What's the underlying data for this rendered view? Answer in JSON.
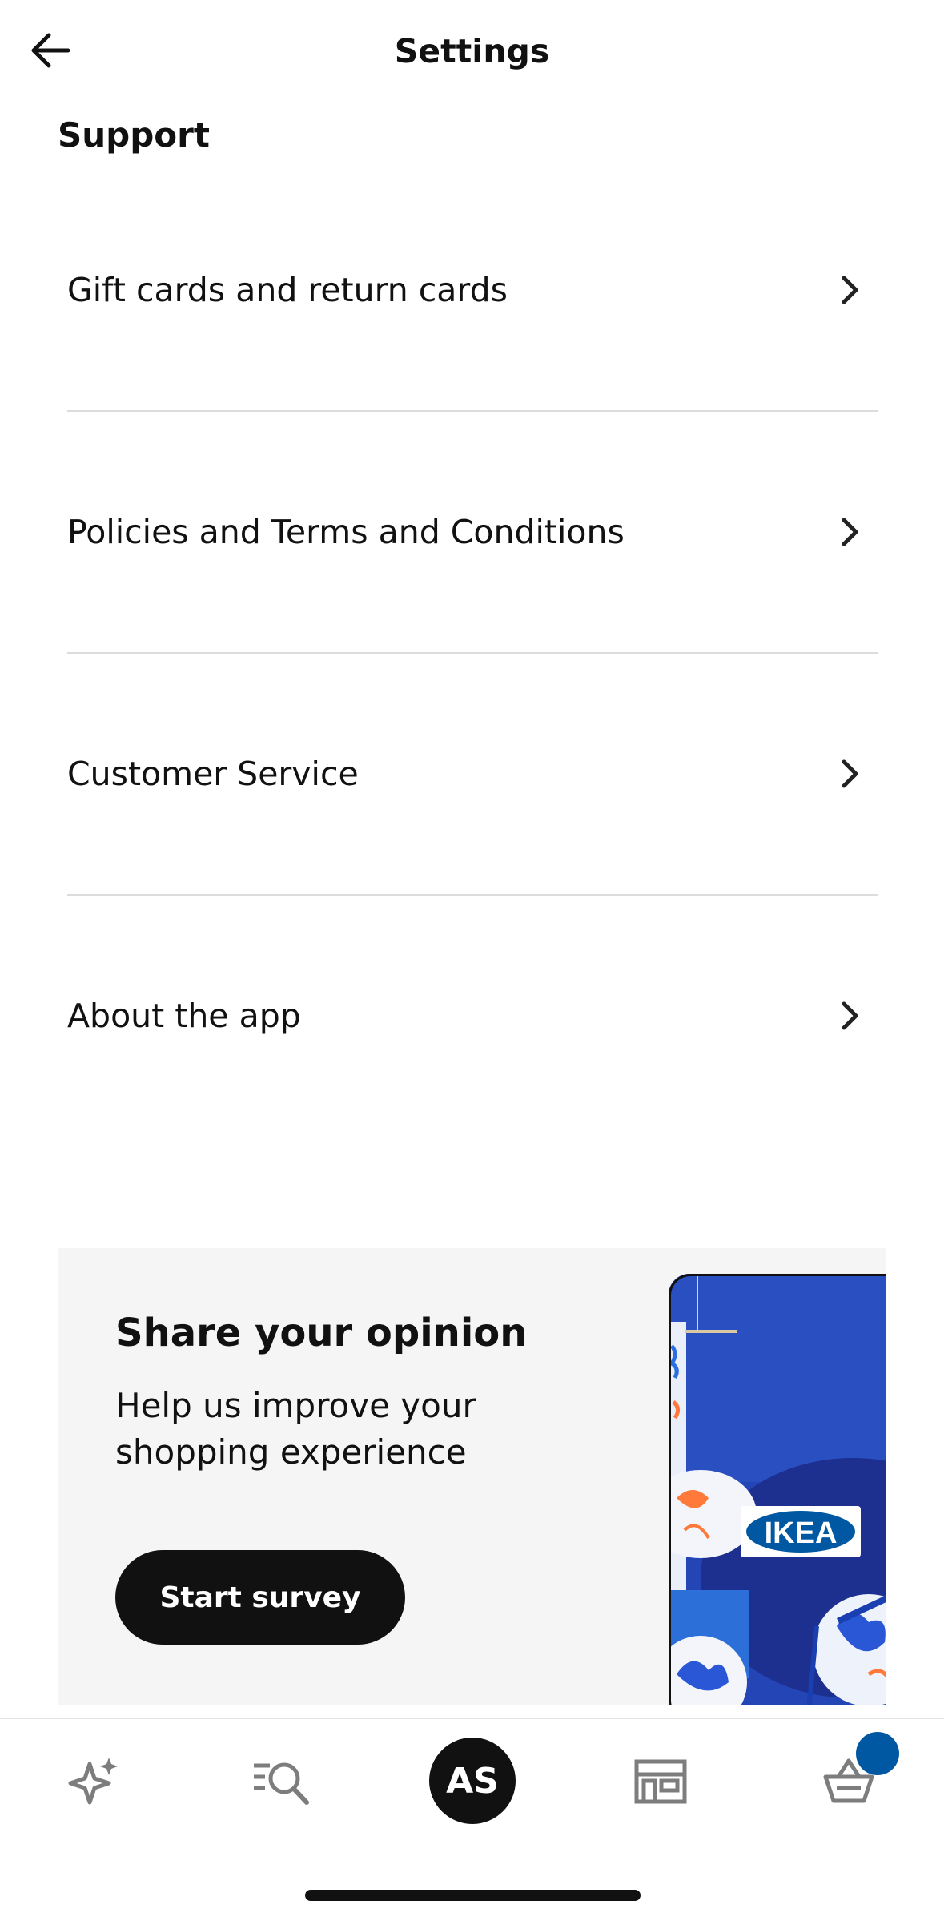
{
  "header": {
    "title": "Settings",
    "back_icon": "arrow-left-icon"
  },
  "section": {
    "heading": "Support"
  },
  "menu": [
    {
      "label": "Gift cards and return cards",
      "icon": "chevron-right-icon"
    },
    {
      "label": "Policies and Terms and Conditions",
      "icon": "chevron-right-icon"
    },
    {
      "label": "Customer Service",
      "icon": "chevron-right-icon"
    },
    {
      "label": "About the app",
      "icon": "chevron-right-icon"
    }
  ],
  "survey": {
    "title": "Share your opinion",
    "text": "Help us improve your shopping experience",
    "button_label": "Start survey",
    "image_logo_text": "IKEA"
  },
  "bottom_nav": {
    "items": [
      "sparkle-icon",
      "search-list-icon",
      "profile-avatar",
      "store-icon",
      "cart-icon"
    ],
    "avatar_initials": "AS",
    "cart_badge_color": "#0058a3"
  },
  "colors": {
    "accent_blue": "#0058a3",
    "text": "#111111",
    "card_bg": "#f5f5f5"
  }
}
